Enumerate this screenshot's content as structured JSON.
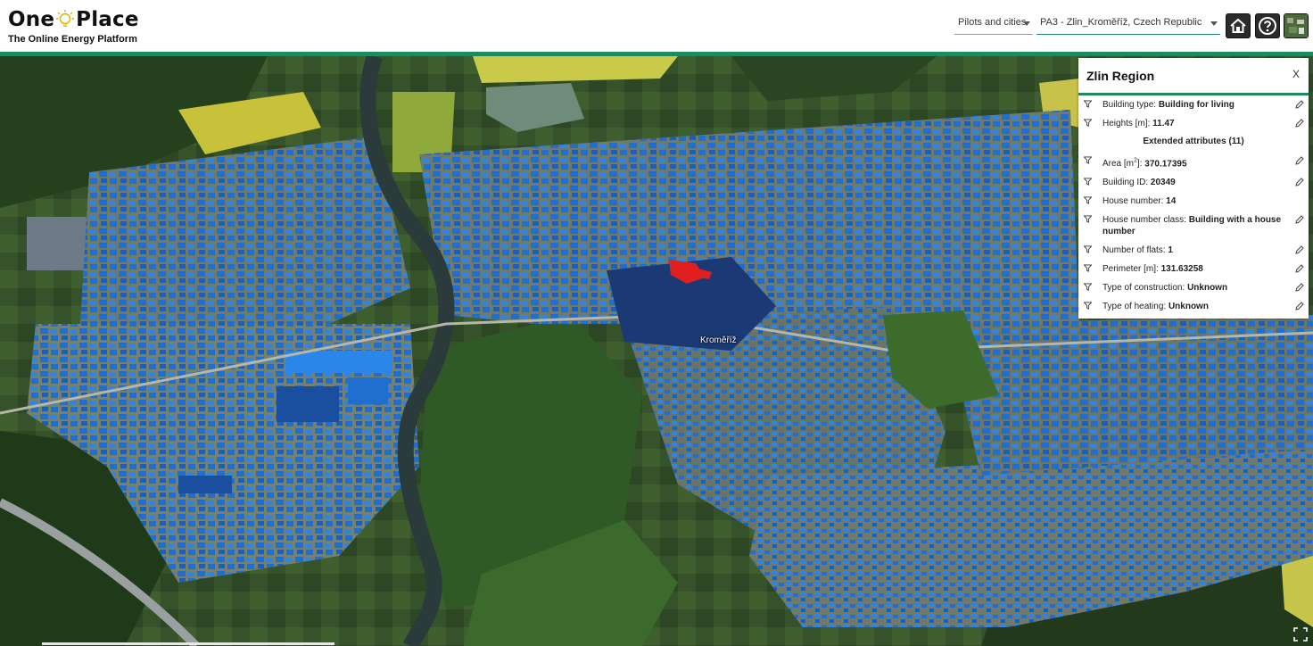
{
  "app": {
    "logo_word_1": "One",
    "logo_word_2": "Place",
    "subtitle": "The Online Energy Platform"
  },
  "header": {
    "pilots_select": "Pilots and cities",
    "region_select": "PA3 - Zlin_Kroměříž, Czech Republic",
    "buttons": [
      "home-icon",
      "help-icon",
      "layers-icon"
    ]
  },
  "map": {
    "city_label": "Kroměříž",
    "colors": {
      "buildings": "#1f6fd1",
      "selected": "#e02020",
      "accent": "#1f8a5b"
    }
  },
  "panel": {
    "title": "Zlin Region",
    "close": "X",
    "attributes": [
      {
        "key": "Building type:",
        "value": "Building for living"
      },
      {
        "key": "Heights [m]:",
        "value": "11.47"
      }
    ],
    "extended_label": "Extended attributes (11)",
    "area_key_prefix": "Area [m",
    "area_key_sup": "2",
    "area_key_suffix": "]:",
    "area_value": "370.17395",
    "extended": [
      {
        "key": "Building ID:",
        "value": "20349"
      },
      {
        "key": "House number:",
        "value": "14"
      },
      {
        "key": "House number class:",
        "value": "Building with a house number"
      },
      {
        "key": "Number of flats:",
        "value": "1"
      },
      {
        "key": "Perimeter [m]:",
        "value": "131.63258"
      },
      {
        "key": "Type of construction:",
        "value": "Unknown"
      },
      {
        "key": "Type of heating:",
        "value": "Unknown"
      }
    ]
  }
}
